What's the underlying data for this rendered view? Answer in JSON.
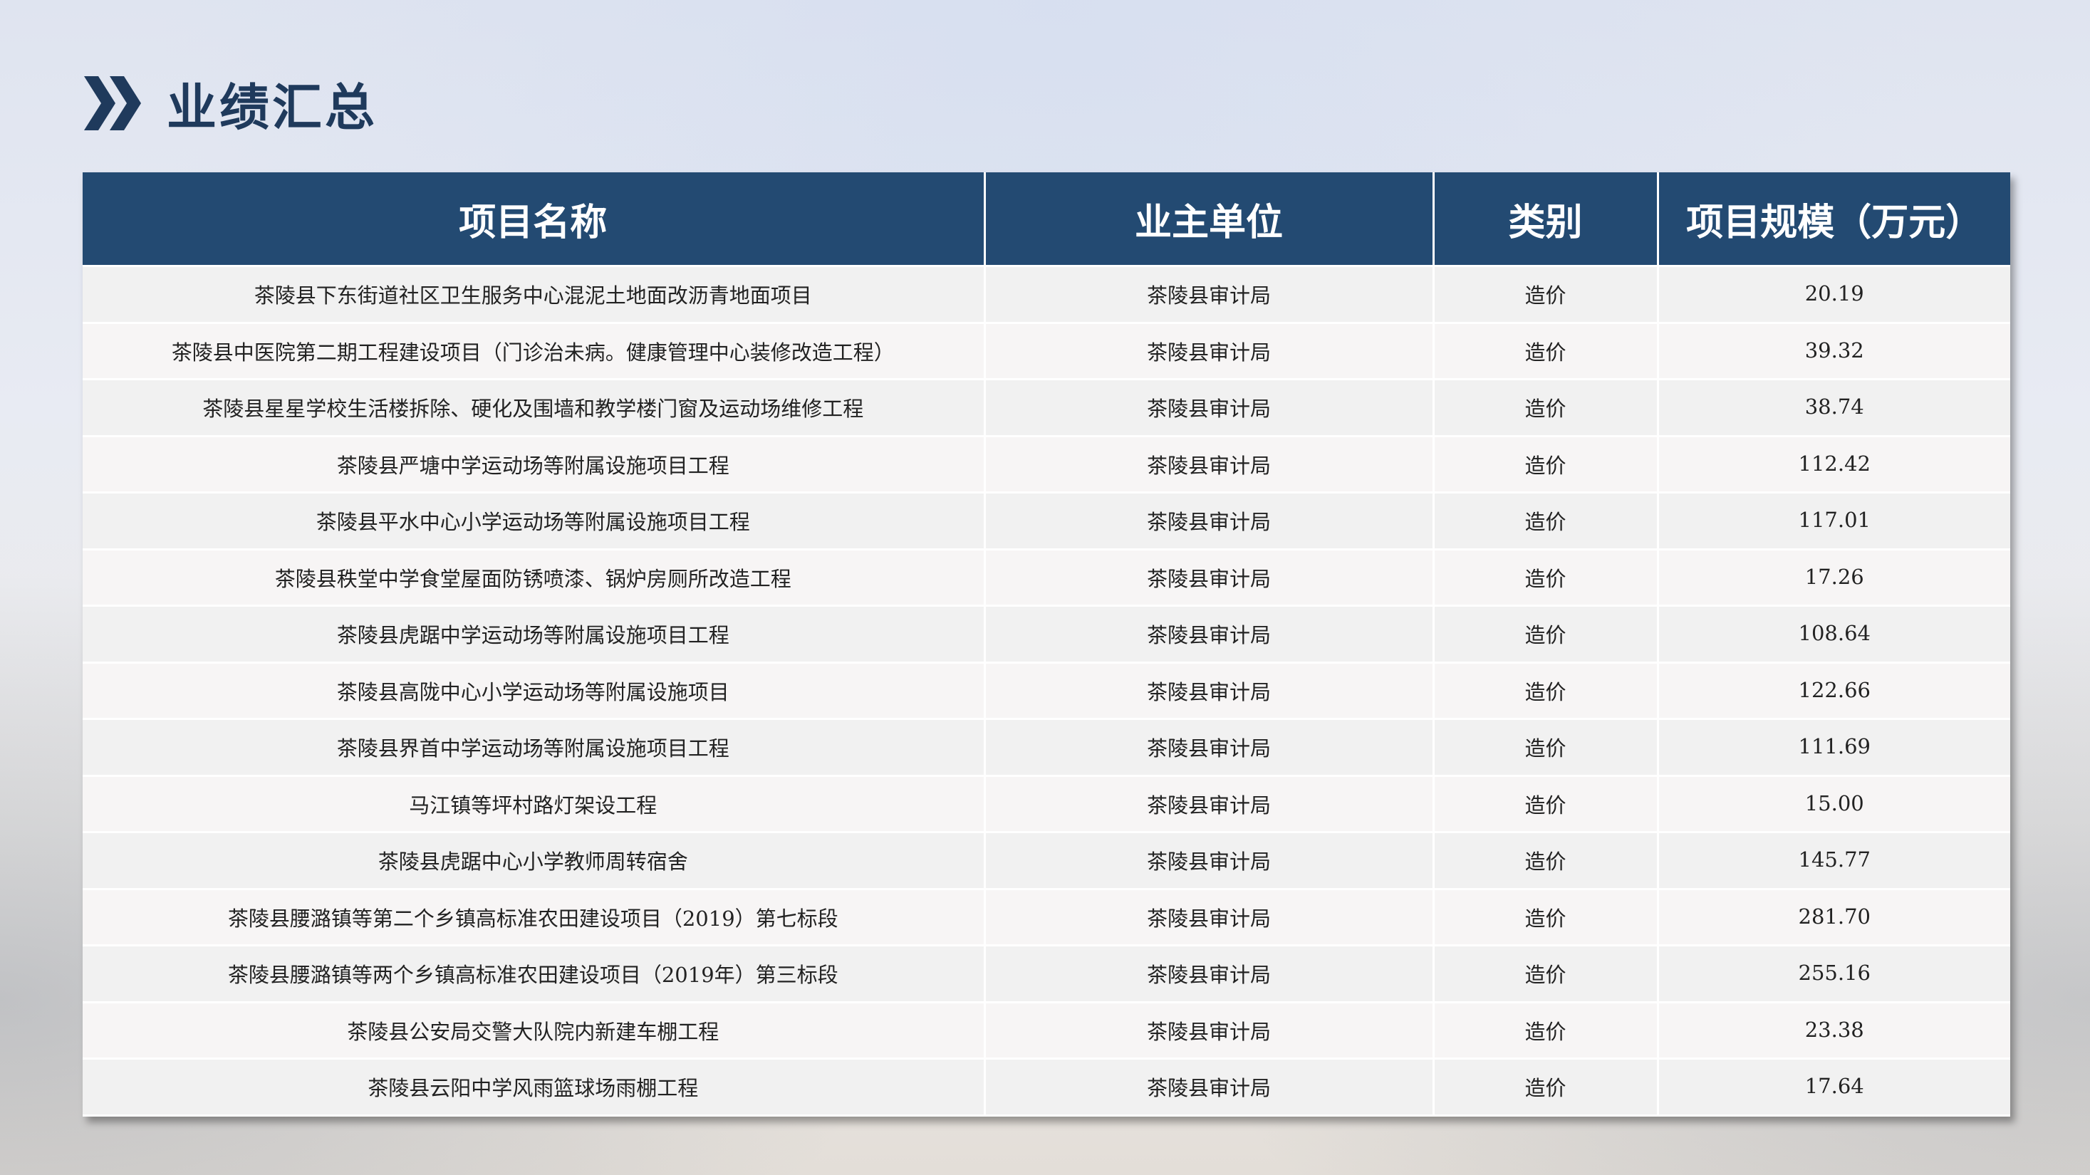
{
  "page": {
    "title": "业绩汇总",
    "title_icon": "double-chevron-right-icon",
    "accent_color": "#234a72"
  },
  "table": {
    "headers": [
      "项目名称",
      "业主单位",
      "类别",
      "项目规模（万元）"
    ],
    "rows": [
      {
        "name": "茶陵县下东街道社区卫生服务中心混泥土地面改沥青地面项目",
        "owner": "茶陵县审计局",
        "type": "造价",
        "scale": "20.19"
      },
      {
        "name": "茶陵县中医院第二期工程建设项目（门诊治未病。健康管理中心装修改造工程）",
        "owner": "茶陵县审计局",
        "type": "造价",
        "scale": "39.32"
      },
      {
        "name": "茶陵县星星学校生活楼拆除、硬化及围墙和教学楼门窗及运动场维修工程",
        "owner": "茶陵县审计局",
        "type": "造价",
        "scale": "38.74"
      },
      {
        "name": "茶陵县严塘中学运动场等附属设施项目工程",
        "owner": "茶陵县审计局",
        "type": "造价",
        "scale": "112.42"
      },
      {
        "name": "茶陵县平水中心小学运动场等附属设施项目工程",
        "owner": "茶陵县审计局",
        "type": "造价",
        "scale": "117.01"
      },
      {
        "name": "茶陵县秩堂中学食堂屋面防锈喷漆、锅炉房厕所改造工程",
        "owner": "茶陵县审计局",
        "type": "造价",
        "scale": "17.26"
      },
      {
        "name": "茶陵县虎踞中学运动场等附属设施项目工程",
        "owner": "茶陵县审计局",
        "type": "造价",
        "scale": "108.64"
      },
      {
        "name": "茶陵县高陇中心小学运动场等附属设施项目",
        "owner": "茶陵县审计局",
        "type": "造价",
        "scale": "122.66"
      },
      {
        "name": "茶陵县界首中学运动场等附属设施项目工程",
        "owner": "茶陵县审计局",
        "type": "造价",
        "scale": "111.69"
      },
      {
        "name": "马江镇等坪村路灯架设工程",
        "owner": "茶陵县审计局",
        "type": "造价",
        "scale": "15.00"
      },
      {
        "name": "茶陵县虎踞中心小学教师周转宿舍",
        "owner": "茶陵县审计局",
        "type": "造价",
        "scale": "145.77"
      },
      {
        "name": "茶陵县腰潞镇等第二个乡镇高标准农田建设项目（2019）第七标段",
        "owner": "茶陵县审计局",
        "type": "造价",
        "scale": "281.70"
      },
      {
        "name": "茶陵县腰潞镇等两个乡镇高标准农田建设项目（2019年）第三标段",
        "owner": "茶陵县审计局",
        "type": "造价",
        "scale": "255.16"
      },
      {
        "name": "茶陵县公安局交警大队院内新建车棚工程",
        "owner": "茶陵县审计局",
        "type": "造价",
        "scale": "23.38"
      },
      {
        "name": "茶陵县云阳中学风雨篮球场雨棚工程",
        "owner": "茶陵县审计局",
        "type": "造价",
        "scale": "17.64"
      }
    ]
  }
}
